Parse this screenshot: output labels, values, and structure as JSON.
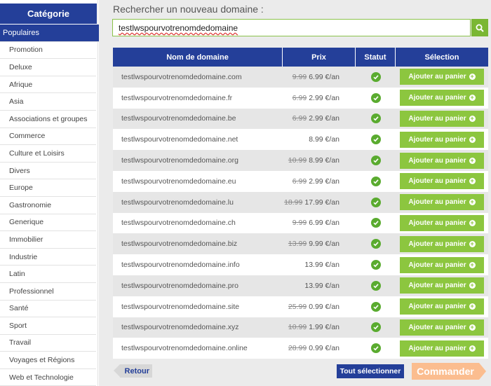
{
  "sidebar": {
    "title": "Catégorie",
    "items": [
      {
        "label": "Populaires",
        "active": true
      },
      {
        "label": "Promotion"
      },
      {
        "label": "Deluxe"
      },
      {
        "label": "Afrique"
      },
      {
        "label": "Asia"
      },
      {
        "label": "Associations et groupes"
      },
      {
        "label": "Commerce"
      },
      {
        "label": "Culture et Loisirs"
      },
      {
        "label": "Divers"
      },
      {
        "label": "Europe"
      },
      {
        "label": "Gastronomie"
      },
      {
        "label": "Generique"
      },
      {
        "label": "Immobilier"
      },
      {
        "label": "Industrie"
      },
      {
        "label": "Latin"
      },
      {
        "label": "Professionnel"
      },
      {
        "label": "Santé"
      },
      {
        "label": "Sport"
      },
      {
        "label": "Travail"
      },
      {
        "label": "Voyages et Régions"
      },
      {
        "label": "Web et Technologie"
      }
    ]
  },
  "search": {
    "label": "Rechercher un nouveau domaine :",
    "value": "testlwspourvotrenomdedomaine",
    "button_icon": "search-icon"
  },
  "table": {
    "headers": {
      "name": "Nom de domaine",
      "price": "Prix",
      "status": "Statut",
      "selection": "Sélection"
    },
    "add_label": "Ajouter au panier",
    "rows": [
      {
        "name": "testlwspourvotrenomdedomaine.com",
        "old": "9.99",
        "price": "6.99 €/an"
      },
      {
        "name": "testlwspourvotrenomdedomaine.fr",
        "old": "6.99",
        "price": "2.99 €/an"
      },
      {
        "name": "testlwspourvotrenomdedomaine.be",
        "old": "6.99",
        "price": "2.99 €/an"
      },
      {
        "name": "testlwspourvotrenomdedomaine.net",
        "old": "",
        "price": "8.99 €/an"
      },
      {
        "name": "testlwspourvotrenomdedomaine.org",
        "old": "10.99",
        "price": "8.99 €/an"
      },
      {
        "name": "testlwspourvotrenomdedomaine.eu",
        "old": "6.99",
        "price": "2.99 €/an"
      },
      {
        "name": "testlwspourvotrenomdedomaine.lu",
        "old": "18.99",
        "price": "17.99 €/an"
      },
      {
        "name": "testlwspourvotrenomdedomaine.ch",
        "old": "9.99",
        "price": "6.99 €/an"
      },
      {
        "name": "testlwspourvotrenomdedomaine.biz",
        "old": "13.99",
        "price": "9.99 €/an"
      },
      {
        "name": "testlwspourvotrenomdedomaine.info",
        "old": "",
        "price": "13.99 €/an"
      },
      {
        "name": "testlwspourvotrenomdedomaine.pro",
        "old": "",
        "price": "13.99 €/an"
      },
      {
        "name": "testlwspourvotrenomdedomaine.site",
        "old": "25.99",
        "price": "0.99 €/an"
      },
      {
        "name": "testlwspourvotrenomdedomaine.xyz",
        "old": "10.99",
        "price": "1.99 €/an"
      },
      {
        "name": "testlwspourvotrenomdedomaine.online",
        "old": "28.99",
        "price": "0.99 €/an"
      }
    ]
  },
  "footer": {
    "back_label": "Retour",
    "select_all_label": "Tout sélectionner",
    "order_label": "Commander"
  },
  "colors": {
    "primary": "#243f99",
    "green": "#8cc63f",
    "check": "#5aab2f",
    "order": "#fbbd8f"
  }
}
